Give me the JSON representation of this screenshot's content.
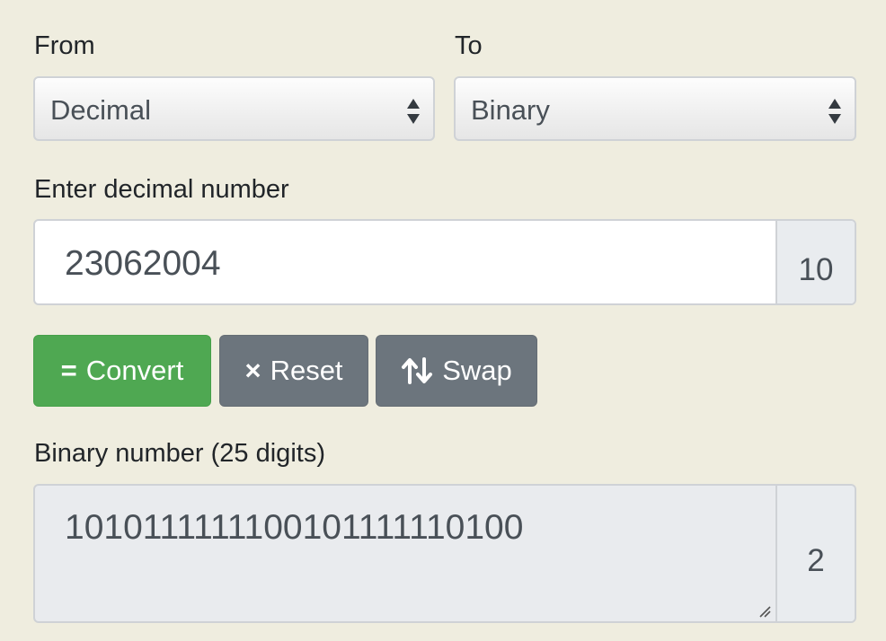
{
  "from": {
    "label": "From",
    "selected": "Decimal"
  },
  "to": {
    "label": "To",
    "selected": "Binary"
  },
  "input": {
    "label": "Enter decimal number",
    "value": "23062004",
    "base": "10"
  },
  "buttons": {
    "convert": {
      "icon": "=",
      "label": "Convert"
    },
    "reset": {
      "icon": "×",
      "label": "Reset"
    },
    "swap": {
      "icon": "swap-vertical-arrows-icon",
      "label": "Swap"
    }
  },
  "output": {
    "label": "Binary number (25 digits)",
    "value": "1010111111100101111110100",
    "base": "2"
  },
  "colors": {
    "page_background": "#efeddf",
    "convert_button": "#4fa852",
    "secondary_button": "#6c757d",
    "addon_background": "#e9ecef",
    "readonly_background": "#e9ebee"
  }
}
